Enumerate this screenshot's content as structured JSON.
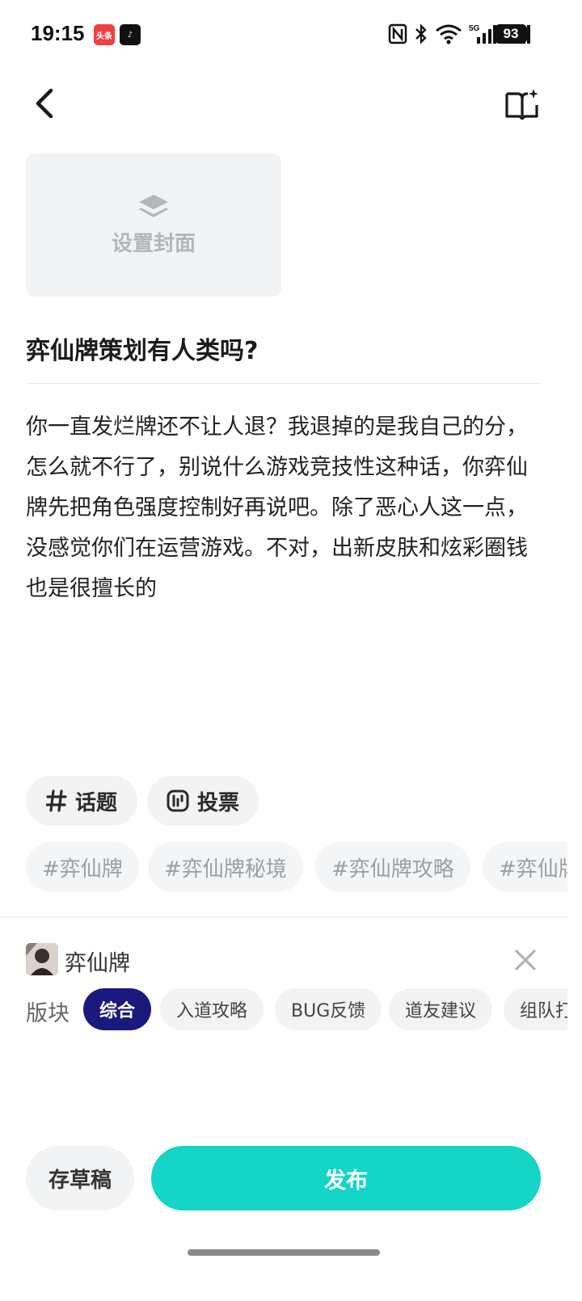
{
  "status_bar": {
    "time": "19:15",
    "app_badges": [
      "头条",
      "♪"
    ],
    "battery": "93",
    "network_labels": [
      "5G",
      "5G"
    ]
  },
  "nav": {
    "back_icon": "chevron-left-icon",
    "guide_icon": "book-sparkle-icon"
  },
  "cover": {
    "label": "设置封面",
    "icon": "layers-icon"
  },
  "post": {
    "title": "弈仙牌策划有人类吗?",
    "body": "你一直发烂牌还不让人退？我退掉的是我自己的分，怎么就不行了，别说什么游戏竞技性这种话，你弈仙牌先把角色强度控制好再说吧。除了恶心人这一点，没感觉你们在运营游戏。不对，出新皮肤和炫彩圈钱也是很擅长的"
  },
  "tools": {
    "topic_label": "话题",
    "vote_label": "投票"
  },
  "tag_suggestions": [
    "#弈仙牌",
    "#弈仙牌秘境",
    "#弈仙牌攻略",
    "#弈仙牌"
  ],
  "game": {
    "name": "弈仙牌"
  },
  "sections": {
    "label": "版块",
    "items": [
      "综合",
      "入道攻略",
      "BUG反馈",
      "道友建议",
      "组队打"
    ],
    "selected": "综合"
  },
  "actions": {
    "draft_label": "存草稿",
    "publish_label": "发布"
  },
  "colors": {
    "accent": "#14d5c6",
    "selected_chip": "#1a1a7e"
  }
}
